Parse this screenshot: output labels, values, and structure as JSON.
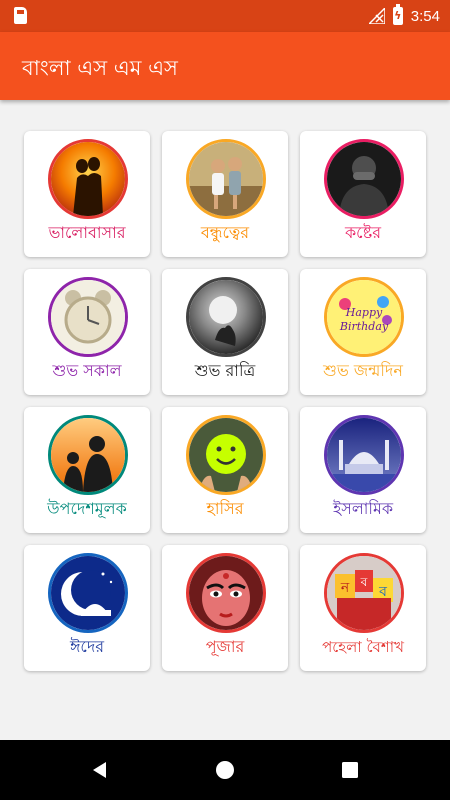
{
  "status": {
    "time": "3:54"
  },
  "appbar": {
    "title": "বাংলা এস এম এস"
  },
  "categories": [
    {
      "label": "ভালোবাসার",
      "color": "#d81b60",
      "border": "#e53935",
      "icon": "couple-silhouette-icon"
    },
    {
      "label": "বন্ধুত্বের",
      "color": "#fb8c00",
      "border": "#f9a825",
      "icon": "friends-children-icon"
    },
    {
      "label": "কষ্টের",
      "color": "#e91e63",
      "border": "#e91e63",
      "icon": "sad-person-icon"
    },
    {
      "label": "শুভ সকাল",
      "color": "#8e24aa",
      "border": "#8e24aa",
      "icon": "alarm-clock-icon"
    },
    {
      "label": "শুভ রাত্রি",
      "color": "#212121",
      "border": "#424242",
      "icon": "moon-night-icon"
    },
    {
      "label": "শুভ জন্মদিন",
      "color": "#f9a825",
      "border": "#f9a825",
      "icon": "birthday-balloons-icon"
    },
    {
      "label": "উপদেশমূলক",
      "color": "#00897b",
      "border": "#00897b",
      "icon": "father-son-silhouette-icon"
    },
    {
      "label": "হাসির",
      "color": "#fb8c00",
      "border": "#f9a825",
      "icon": "smiley-balloon-icon"
    },
    {
      "label": "ইসলামিক",
      "color": "#5e35b1",
      "border": "#5e35b1",
      "icon": "mosque-icon"
    },
    {
      "label": "ঈদের",
      "color": "#1e3a9e",
      "border": "#1565c0",
      "icon": "crescent-moon-icon"
    },
    {
      "label": "পূজার",
      "color": "#e53935",
      "border": "#e53935",
      "icon": "goddess-face-icon"
    },
    {
      "label": "পহেলা বৈশাখ",
      "color": "#e53935",
      "border": "#e53935",
      "icon": "new-year-letters-icon"
    }
  ],
  "colors": {
    "statusbar": "#d84315",
    "appbar": "#f4511e",
    "background": "#f2f2f2"
  }
}
